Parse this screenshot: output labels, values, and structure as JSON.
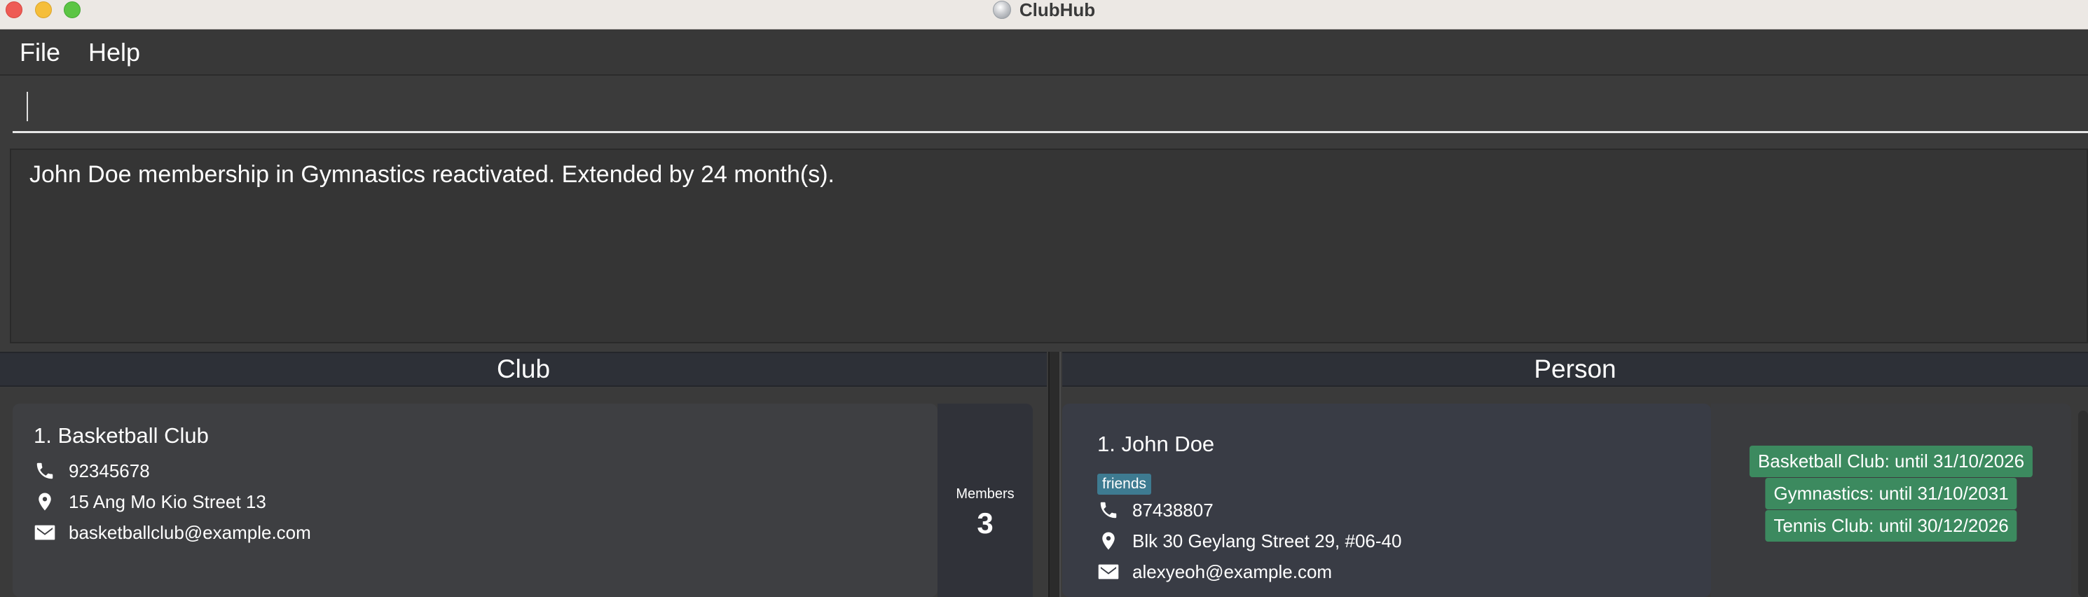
{
  "window": {
    "title": "ClubHub"
  },
  "menu": [
    "File",
    "Help"
  ],
  "command": {
    "value": ""
  },
  "result": {
    "message": "John Doe membership in Gymnastics reactivated. Extended by 24 month(s)."
  },
  "club_panel": {
    "title": "Club",
    "clubs": [
      {
        "name": "1. Basketball Club",
        "phone": "92345678",
        "address": "15 Ang Mo Kio Street 13",
        "email": "basketballclub@example.com",
        "members_label": "Members",
        "members_count": "3"
      }
    ]
  },
  "person_panel": {
    "title": "Person",
    "persons": [
      {
        "name": "1. John Doe",
        "tags": [
          "friends"
        ],
        "phone": "87438807",
        "address": "Blk 30 Geylang Street 29, #06-40",
        "email": "alexyeoh@example.com",
        "memberships": [
          "Basketball Club: until 31/10/2026",
          "Gymnastics: until 31/10/2031",
          "Tennis Club: until 30/12/2026"
        ]
      }
    ]
  },
  "colors": {
    "tag": "#3e7b91",
    "membership_badge": "#3c8a5f",
    "background": "#3b3b3b"
  },
  "icons": [
    "phone-icon",
    "location-pin-icon",
    "email-icon"
  ]
}
